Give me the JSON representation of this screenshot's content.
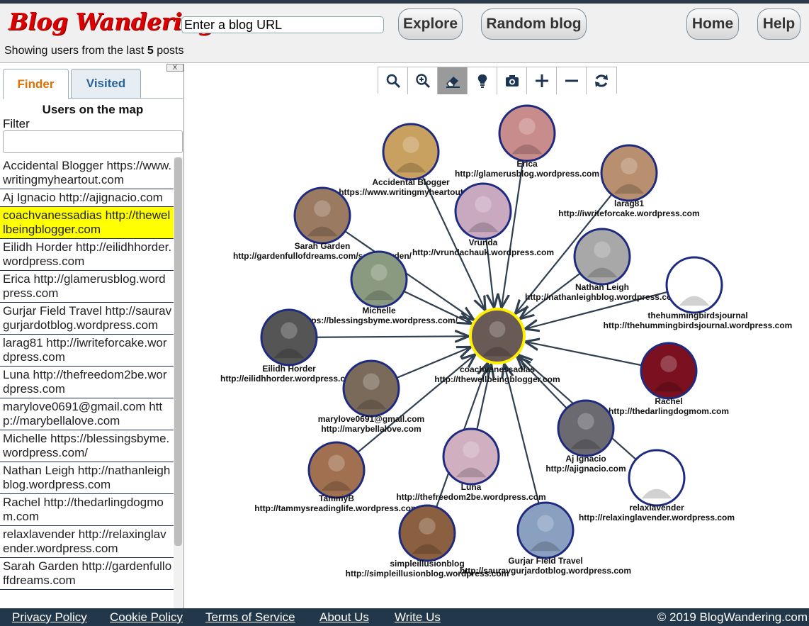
{
  "header": {
    "logo": "Blog Wandering",
    "url_placeholder": "Enter a blog URL",
    "explore_label": "Explore",
    "random_label": "Random blog",
    "home_label": "Home",
    "help_label": "Help",
    "showing_prefix": "Showing users from the last",
    "showing_count": "5",
    "showing_suffix": "posts"
  },
  "sidebar": {
    "close_label": "X",
    "tabs": [
      {
        "label": "Finder"
      },
      {
        "label": "Visited"
      }
    ],
    "title": "Users on the map",
    "filter_label": "Filter",
    "users": [
      {
        "text": "Accidental Blogger https://www.writingmyheartout.com"
      },
      {
        "text": "Aj Ignacio http://ajignacio.com"
      },
      {
        "text": "coachvanessadias http://thewellbeingblogger.com"
      },
      {
        "text": "Eilidh Horder http://eilidhhorder.wordpress.com"
      },
      {
        "text": "Erica http://glamerusblog.wordpress.com"
      },
      {
        "text": "Gurjar Field Travel http://sauravgurjardotblog.wordpress.com"
      },
      {
        "text": "larag81 http://iwriteforcake.wordpress.com"
      },
      {
        "text": "Luna http://thefreedom2be.wordpress.com"
      },
      {
        "text": "marylove0691@gmail.com http://marybellalove.com"
      },
      {
        "text": "Michelle https://blessingsbyme.wordpress.com/"
      },
      {
        "text": "Nathan Leigh http://nathanleighblog.wordpress.com"
      },
      {
        "text": "Rachel http://thedarlingdogmom.com"
      },
      {
        "text": "relaxlavender http://relaxinglavender.wordpress.com"
      },
      {
        "text": "Sarah Garden http://gardenfulloffdreams.com"
      }
    ],
    "highlight_color": "#ffff00"
  },
  "toolbar": {
    "tools": [
      {
        "icon": "search-icon"
      },
      {
        "icon": "zoom-in-icon"
      },
      {
        "icon": "eraser-icon",
        "active": true
      },
      {
        "icon": "lightbulb-icon"
      },
      {
        "icon": "camera-icon"
      },
      {
        "icon": "plus-icon"
      },
      {
        "icon": "minus-icon"
      },
      {
        "icon": "refresh-icon"
      }
    ]
  },
  "graph": {
    "center": {
      "name": "coachvanessadias",
      "url": "http://thewellbeingblogger.com",
      "ring_color": "#ffee00"
    },
    "nodes": [
      {
        "name": "Accidental Blogger",
        "url": "https://www.writingmyheartout.com",
        "fill": "#c8a060"
      },
      {
        "name": "Erica",
        "url": "http://glamerusblog.wordpress.com",
        "fill": "#c98c8c"
      },
      {
        "name": "larag81",
        "url": "http://iwriteforcake.wordpress.com",
        "fill": "#b89070"
      },
      {
        "name": "Sarah Garden",
        "url": "http://gardenfullofdreams.com/sarahgarden/",
        "fill": "#9a7a60"
      },
      {
        "name": "Vrunda",
        "url": "http://vrundachauk.wordpress.com",
        "fill": "#c9a9c0"
      },
      {
        "name": "Nathan Leigh",
        "url": "http://nathanleighblog.wordpress.com",
        "fill": "#a8a8a8"
      },
      {
        "name": "thehummingbirdsjournal",
        "url": "http://thehummingbirdsjournal.wordpress.com",
        "fill": "#ffffff"
      },
      {
        "name": "Michelle",
        "url": "https://blessingsbyme.wordpress.com/",
        "fill": "#8a9a80"
      },
      {
        "name": "Eilidh Horder",
        "url": "http://eilidhhorder.wordpress.com",
        "fill": "#555555"
      },
      {
        "name": "Rachel",
        "url": "http://thedarlingdogmom.com",
        "fill": "#7a1020"
      },
      {
        "name": "marylove0691@gmail.com",
        "url": "http://marybellalove.com",
        "fill": "#7a6a5a"
      },
      {
        "name": "Aj Ignacio",
        "url": "http://ajignacio.com",
        "fill": "#6a6a70"
      },
      {
        "name": "TammyB",
        "url": "http://tammysreadinglife.wordpress.com",
        "fill": "#a07050"
      },
      {
        "name": "Luna",
        "url": "http://thefreedom2be.wordpress.com",
        "fill": "#d0b0c0"
      },
      {
        "name": "relaxlavender",
        "url": "http://relaxinglavender.wordpress.com",
        "fill": "#ffffff"
      },
      {
        "name": "simpleillusionblog",
        "url": "http://simpleillusionblog.wordpress.com",
        "fill": "#8a6040"
      },
      {
        "name": "Gurjar Field Travel",
        "url": "http://sauravgurjardotblog.wordpress.com",
        "fill": "#8aa0c0"
      }
    ],
    "node_ring_color": "#1e2a80",
    "edge_color": "#2f3f4f"
  },
  "footer": {
    "links": [
      {
        "label": "Privacy Policy"
      },
      {
        "label": "Cookie Policy"
      },
      {
        "label": "Terms of Service"
      },
      {
        "label": "About Us"
      },
      {
        "label": "Write Us"
      }
    ],
    "copyright": "© 2019 BlogWandering.com"
  }
}
